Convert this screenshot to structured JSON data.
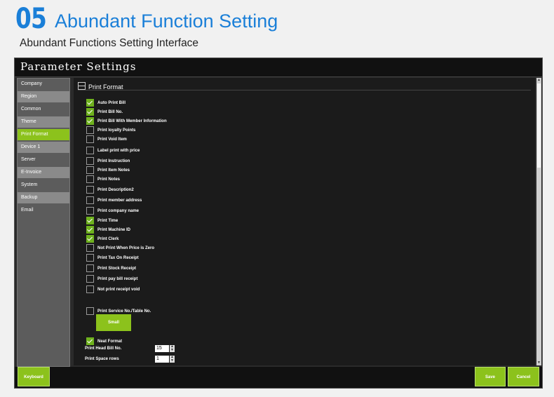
{
  "hero": {
    "number": "05",
    "title": "Abundant Function Setting",
    "subtitle": "Abundant Functions Setting Interface"
  },
  "window": {
    "title": "Parameter Settings"
  },
  "sidebar": {
    "items": [
      {
        "label": "Company"
      },
      {
        "label": "Region"
      },
      {
        "label": "Common"
      },
      {
        "label": "Theme"
      },
      {
        "label": "Print Format",
        "active": true
      },
      {
        "label": "Device 1"
      },
      {
        "label": "Server"
      },
      {
        "label": "E-Invoice"
      },
      {
        "label": "System"
      },
      {
        "label": "Backup"
      },
      {
        "label": "Email"
      }
    ]
  },
  "section": {
    "title": "Print Format"
  },
  "options": [
    {
      "label": "Auto Print Bill",
      "checked": true
    },
    {
      "label": "Print Bill No.",
      "checked": true
    },
    {
      "label": "Print Bill With Member Information",
      "checked": true
    },
    {
      "label": "Print loyalty Points",
      "checked": false
    },
    {
      "label": "Print Void Item",
      "checked": false
    },
    {
      "label": "Label print with price",
      "checked": false
    },
    {
      "label": "Print Instruction",
      "checked": false
    },
    {
      "label": "Print Item Notes",
      "checked": false
    },
    {
      "label": "Print Notes",
      "checked": false
    },
    {
      "label": "Print Description2",
      "checked": false
    },
    {
      "label": "Print member address",
      "checked": false
    },
    {
      "label": "Print company name",
      "checked": false
    },
    {
      "label": "Print Time",
      "checked": true
    },
    {
      "label": "Print Machine ID",
      "checked": true
    },
    {
      "label": "Print Clerk",
      "checked": true
    },
    {
      "label": "Not Print When Price is Zero",
      "checked": false
    },
    {
      "label": "Print Tax On Receipt",
      "checked": false
    },
    {
      "label": "Print Stock Receipt",
      "checked": false
    },
    {
      "label": "Print pay bill receipt",
      "checked": false
    },
    {
      "label": "Not print receipt void",
      "checked": false
    },
    {
      "label": "Print Service No./Table No.",
      "checked": false
    },
    {
      "label": "Neat Format",
      "checked": true
    }
  ],
  "size_button": {
    "label": "Small"
  },
  "numeric": [
    {
      "label": "Print Head Bill No.",
      "value": "15"
    },
    {
      "label": "Print Space rows",
      "value": "1"
    }
  ],
  "footer": {
    "keyboard_label": "Keyboard",
    "save_label": "Save",
    "cancel_label": "Cancel"
  },
  "colors": {
    "accent": "#8cc21c",
    "brand_blue": "#1a7fd8",
    "check": "#6fb21e"
  }
}
